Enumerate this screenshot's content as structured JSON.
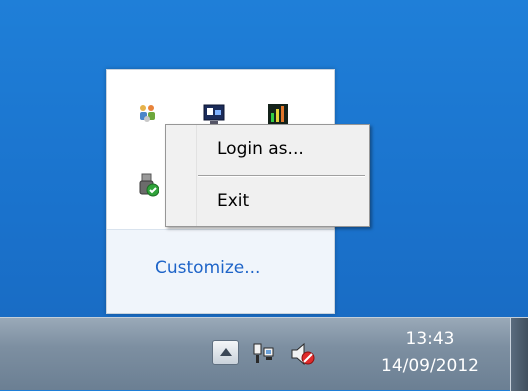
{
  "flyout": {
    "customize_label": "Customize...",
    "icons": [
      "people-app-icon",
      "monitor-app-icon",
      "equalizer-app-icon",
      "usb-device-safe-icon"
    ]
  },
  "context_menu": {
    "items": [
      {
        "label": "Login as..."
      },
      {
        "label": "Exit"
      }
    ]
  },
  "taskbar": {
    "time": "13:43",
    "date": "14/09/2012",
    "icons": [
      "show-hidden-icons-arrow",
      "network-icon",
      "volume-muted-icon"
    ]
  }
}
